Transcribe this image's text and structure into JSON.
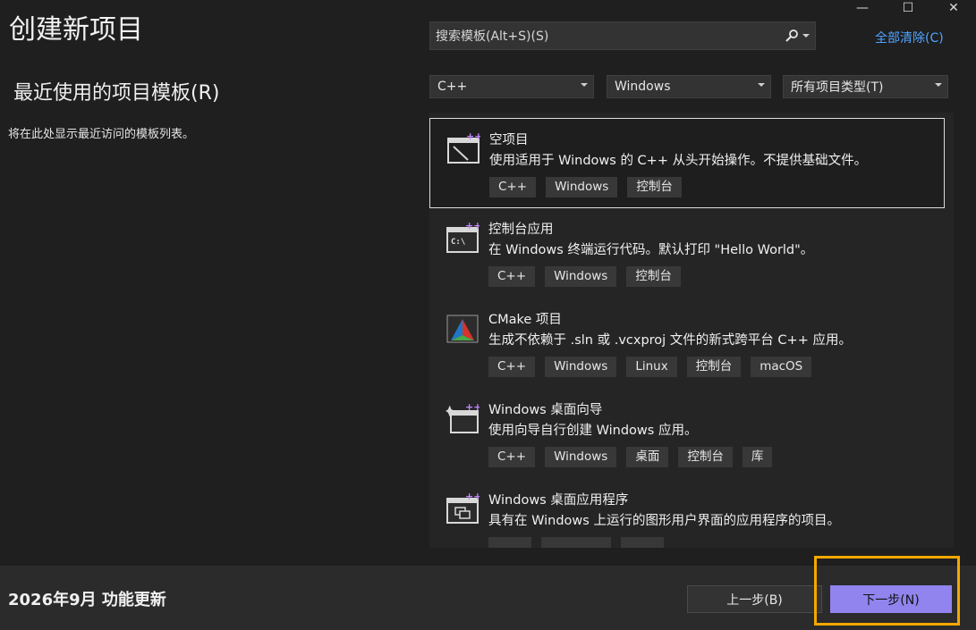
{
  "window": {
    "title": "创建新项目",
    "controls": [
      "—",
      "☐",
      "✕"
    ]
  },
  "search": {
    "placeholder": "搜索模板(Alt+S)(S)",
    "clear_all": "全部清除(C)"
  },
  "recent": {
    "title": "最近使用的项目模板(R)",
    "empty_message": "将在此处显示最近访问的模板列表。"
  },
  "filters": {
    "language": "C++",
    "platform": "Windows",
    "project_type": "所有项目类型(T)"
  },
  "templates": [
    {
      "name": "空项目",
      "description": "使用适用于 Windows 的 C++ 从头开始操作。不提供基础文件。",
      "tags": [
        "C++",
        "Windows",
        "控制台"
      ],
      "icon": "empty-project-icon"
    },
    {
      "name": "控制台应用",
      "description": "在 Windows 终端运行代码。默认打印 \"Hello World\"。",
      "tags": [
        "C++",
        "Windows",
        "控制台"
      ],
      "icon": "console-app-icon"
    },
    {
      "name": "CMake 项目",
      "description": "生成不依赖于 .sln 或 .vcxproj 文件的新式跨平台 C++ 应用。",
      "tags": [
        "C++",
        "Windows",
        "Linux",
        "控制台",
        "macOS"
      ],
      "icon": "cmake-icon"
    },
    {
      "name": "Windows 桌面向导",
      "description": "使用向导自行创建 Windows 应用。",
      "tags": [
        "C++",
        "Windows",
        "桌面",
        "控制台",
        "库"
      ],
      "icon": "desktop-wizard-icon"
    },
    {
      "name": "Windows 桌面应用程序",
      "description": "具有在 Windows 上运行的图形用户界面的应用程序的项目。",
      "tags": [
        "",
        "",
        ""
      ],
      "icon": "desktop-app-icon"
    }
  ],
  "footer": {
    "update_text": "2026年9月 功能更新",
    "back_label": "上一步(B)",
    "next_label": "下一步(N)"
  },
  "colors": {
    "background": "#1f1f1f",
    "accent": "#9184ee",
    "link": "#4fa4ff",
    "highlight": "#f5a800"
  }
}
